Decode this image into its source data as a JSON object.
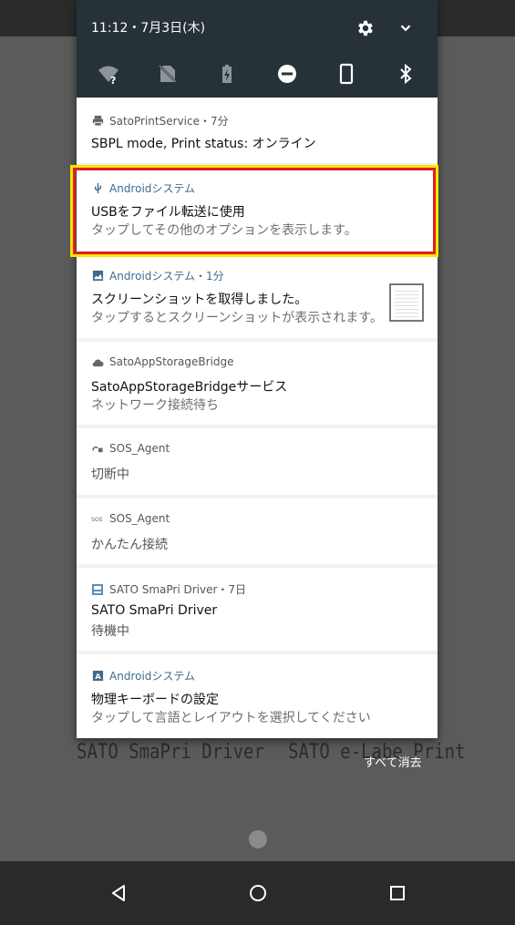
{
  "background": {
    "left_label": "SATO SmaPri Driver",
    "right_label": "SATO e-Labe Print"
  },
  "status": {
    "time_date": "11:12・7月3日(木)"
  },
  "quick_settings": {
    "tiles": [
      "wifi-unknown-icon",
      "no-sim-icon",
      "battery-charging-icon",
      "do-not-disturb-icon",
      "screen-rotation-icon",
      "bluetooth-icon"
    ]
  },
  "notifications": [
    {
      "app": "SatoPrintService・7分",
      "icon": "printer-icon",
      "title": "SBPL mode, Print status: オンライン",
      "text": ""
    },
    {
      "app": "Androidシステム",
      "icon": "usb-icon",
      "title": "USBをファイル転送に使用",
      "text": "タップしてその他のオプションを表示します。"
    },
    {
      "app": "Androidシステム・1分",
      "icon": "image-icon",
      "title": "スクリーンショットを取得しました。",
      "text": "タップするとスクリーンショットが表示されます。"
    },
    {
      "app": "SatoAppStorageBridge",
      "icon": "cloud-icon",
      "title": "SatoAppStorageBridgeサービス",
      "text": "ネットワーク接続待ち"
    },
    {
      "app": "SOS_Agent",
      "icon": "link-icon",
      "title": "",
      "text": "切断中"
    },
    {
      "app": "SOS_Agent",
      "icon": "sos-icon",
      "title": "",
      "text": "かんたん接続"
    },
    {
      "app": "SATO SmaPri Driver・7日",
      "icon": "printer-app-icon",
      "title": "SATO SmaPri Driver",
      "text": "待機中"
    },
    {
      "app": "Androidシステム",
      "icon": "keyboard-icon",
      "title": "物理キーボードの設定",
      "text": "タップして言語とレイアウトを選択してください"
    }
  ],
  "actions": {
    "clear_all": "すべて消去"
  },
  "colors": {
    "shade_header": "#263238",
    "highlight_outer": "#f5e600",
    "highlight_inner": "#e02020",
    "android_accent": "#3d6b8e"
  }
}
